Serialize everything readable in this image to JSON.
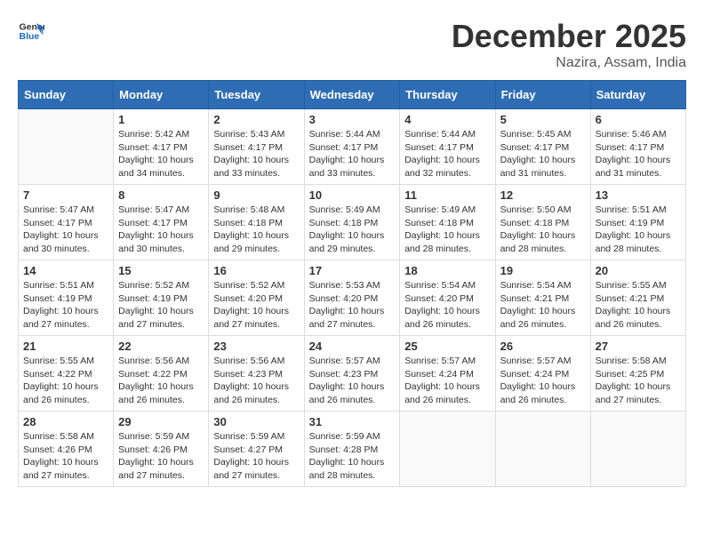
{
  "header": {
    "logo_general": "General",
    "logo_blue": "Blue",
    "month_title": "December 2025",
    "location": "Nazira, Assam, India"
  },
  "weekdays": [
    "Sunday",
    "Monday",
    "Tuesday",
    "Wednesday",
    "Thursday",
    "Friday",
    "Saturday"
  ],
  "weeks": [
    [
      {
        "day": "",
        "info": ""
      },
      {
        "day": "1",
        "info": "Sunrise: 5:42 AM\nSunset: 4:17 PM\nDaylight: 10 hours\nand 34 minutes."
      },
      {
        "day": "2",
        "info": "Sunrise: 5:43 AM\nSunset: 4:17 PM\nDaylight: 10 hours\nand 33 minutes."
      },
      {
        "day": "3",
        "info": "Sunrise: 5:44 AM\nSunset: 4:17 PM\nDaylight: 10 hours\nand 33 minutes."
      },
      {
        "day": "4",
        "info": "Sunrise: 5:44 AM\nSunset: 4:17 PM\nDaylight: 10 hours\nand 32 minutes."
      },
      {
        "day": "5",
        "info": "Sunrise: 5:45 AM\nSunset: 4:17 PM\nDaylight: 10 hours\nand 31 minutes."
      },
      {
        "day": "6",
        "info": "Sunrise: 5:46 AM\nSunset: 4:17 PM\nDaylight: 10 hours\nand 31 minutes."
      }
    ],
    [
      {
        "day": "7",
        "info": "Sunrise: 5:47 AM\nSunset: 4:17 PM\nDaylight: 10 hours\nand 30 minutes."
      },
      {
        "day": "8",
        "info": "Sunrise: 5:47 AM\nSunset: 4:17 PM\nDaylight: 10 hours\nand 30 minutes."
      },
      {
        "day": "9",
        "info": "Sunrise: 5:48 AM\nSunset: 4:18 PM\nDaylight: 10 hours\nand 29 minutes."
      },
      {
        "day": "10",
        "info": "Sunrise: 5:49 AM\nSunset: 4:18 PM\nDaylight: 10 hours\nand 29 minutes."
      },
      {
        "day": "11",
        "info": "Sunrise: 5:49 AM\nSunset: 4:18 PM\nDaylight: 10 hours\nand 28 minutes."
      },
      {
        "day": "12",
        "info": "Sunrise: 5:50 AM\nSunset: 4:18 PM\nDaylight: 10 hours\nand 28 minutes."
      },
      {
        "day": "13",
        "info": "Sunrise: 5:51 AM\nSunset: 4:19 PM\nDaylight: 10 hours\nand 28 minutes."
      }
    ],
    [
      {
        "day": "14",
        "info": "Sunrise: 5:51 AM\nSunset: 4:19 PM\nDaylight: 10 hours\nand 27 minutes."
      },
      {
        "day": "15",
        "info": "Sunrise: 5:52 AM\nSunset: 4:19 PM\nDaylight: 10 hours\nand 27 minutes."
      },
      {
        "day": "16",
        "info": "Sunrise: 5:52 AM\nSunset: 4:20 PM\nDaylight: 10 hours\nand 27 minutes."
      },
      {
        "day": "17",
        "info": "Sunrise: 5:53 AM\nSunset: 4:20 PM\nDaylight: 10 hours\nand 27 minutes."
      },
      {
        "day": "18",
        "info": "Sunrise: 5:54 AM\nSunset: 4:20 PM\nDaylight: 10 hours\nand 26 minutes."
      },
      {
        "day": "19",
        "info": "Sunrise: 5:54 AM\nSunset: 4:21 PM\nDaylight: 10 hours\nand 26 minutes."
      },
      {
        "day": "20",
        "info": "Sunrise: 5:55 AM\nSunset: 4:21 PM\nDaylight: 10 hours\nand 26 minutes."
      }
    ],
    [
      {
        "day": "21",
        "info": "Sunrise: 5:55 AM\nSunset: 4:22 PM\nDaylight: 10 hours\nand 26 minutes."
      },
      {
        "day": "22",
        "info": "Sunrise: 5:56 AM\nSunset: 4:22 PM\nDaylight: 10 hours\nand 26 minutes."
      },
      {
        "day": "23",
        "info": "Sunrise: 5:56 AM\nSunset: 4:23 PM\nDaylight: 10 hours\nand 26 minutes."
      },
      {
        "day": "24",
        "info": "Sunrise: 5:57 AM\nSunset: 4:23 PM\nDaylight: 10 hours\nand 26 minutes."
      },
      {
        "day": "25",
        "info": "Sunrise: 5:57 AM\nSunset: 4:24 PM\nDaylight: 10 hours\nand 26 minutes."
      },
      {
        "day": "26",
        "info": "Sunrise: 5:57 AM\nSunset: 4:24 PM\nDaylight: 10 hours\nand 26 minutes."
      },
      {
        "day": "27",
        "info": "Sunrise: 5:58 AM\nSunset: 4:25 PM\nDaylight: 10 hours\nand 27 minutes."
      }
    ],
    [
      {
        "day": "28",
        "info": "Sunrise: 5:58 AM\nSunset: 4:26 PM\nDaylight: 10 hours\nand 27 minutes."
      },
      {
        "day": "29",
        "info": "Sunrise: 5:59 AM\nSunset: 4:26 PM\nDaylight: 10 hours\nand 27 minutes."
      },
      {
        "day": "30",
        "info": "Sunrise: 5:59 AM\nSunset: 4:27 PM\nDaylight: 10 hours\nand 27 minutes."
      },
      {
        "day": "31",
        "info": "Sunrise: 5:59 AM\nSunset: 4:28 PM\nDaylight: 10 hours\nand 28 minutes."
      },
      {
        "day": "",
        "info": ""
      },
      {
        "day": "",
        "info": ""
      },
      {
        "day": "",
        "info": ""
      }
    ]
  ]
}
